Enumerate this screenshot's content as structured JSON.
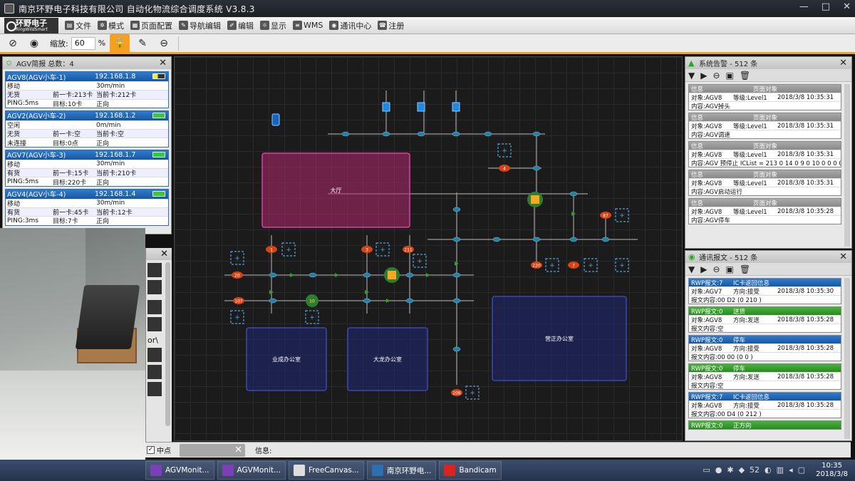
{
  "window": {
    "title": "南京环野电子科技有限公司   自动化物流综合调度系统 V3.8.3",
    "controls": [
      "—",
      "□",
      "✕"
    ]
  },
  "brand": {
    "cn": "环野电子",
    "en": "RingWildSmart"
  },
  "menu": [
    {
      "label": "文件",
      "icon": "file-icon"
    },
    {
      "label": "模式",
      "icon": "gear-icon"
    },
    {
      "label": "页面配置",
      "icon": "layout-icon"
    },
    {
      "label": "导航编辑",
      "icon": "nav-edit-icon"
    },
    {
      "label": "编辑",
      "icon": "edit-icon"
    },
    {
      "label": "显示",
      "icon": "display-icon"
    },
    {
      "label": "WMS",
      "icon": "database-icon"
    },
    {
      "label": "通讯中心",
      "icon": "comm-icon"
    },
    {
      "label": "注册",
      "icon": "register-icon"
    }
  ],
  "toolbar": {
    "zoom_label": "缩放:",
    "zoom_value": "60",
    "zoom_unit": "%"
  },
  "agv_panel": {
    "title": "AGV简报 总数：4",
    "items": [
      {
        "name": "AGV8(AGV小车-1)",
        "ip": "192.168.1.8",
        "battery": "low",
        "rows": [
          [
            "移动",
            "",
            "30m/min"
          ],
          [
            "无货",
            "前一卡:213卡",
            "当前卡:212卡"
          ],
          [
            "PING:5ms",
            "目标:10卡",
            "正向"
          ]
        ]
      },
      {
        "name": "AGV2(AGV小车-2)",
        "ip": "192.168.1.2",
        "battery": "ok",
        "rows": [
          [
            "空闲",
            "",
            "0m/min"
          ],
          [
            "无货",
            "前一卡:空",
            "当前卡:空"
          ],
          [
            "未连接",
            "目标:0点",
            "正向"
          ]
        ]
      },
      {
        "name": "AGV7(AGV小车-3)",
        "ip": "192.168.1.7",
        "battery": "ok",
        "rows": [
          [
            "移动",
            "",
            "30m/min"
          ],
          [
            "有货",
            "前一卡:15卡",
            "当前卡:210卡"
          ],
          [
            "PING:5ms",
            "目标:220卡",
            "正向"
          ]
        ]
      },
      {
        "name": "AGV4(AGV小车-4)",
        "ip": "192.168.1.4",
        "battery": "ok",
        "rows": [
          [
            "移动",
            "",
            "30m/min"
          ],
          [
            "有货",
            "前一卡:45卡",
            "当前卡:12卡"
          ],
          [
            "PING:3ms",
            "目标:7卡",
            "正向"
          ]
        ]
      }
    ]
  },
  "lower_left": {
    "text": "or\\"
  },
  "bottombar": {
    "checkbox_label": "中点",
    "info_label": "信息:"
  },
  "map": {
    "rooms": [
      {
        "label": "大厅",
        "style": "pink"
      },
      {
        "label": "业成办公室",
        "style": "blue"
      },
      {
        "label": "大龙办公室",
        "style": "blue"
      },
      {
        "label": "营正办公室",
        "style": "blue"
      }
    ],
    "card_labels": [
      "1",
      "3",
      "211",
      "20",
      "107",
      "10",
      "4",
      "87",
      "220",
      "7",
      "208"
    ]
  },
  "alarm_panel": {
    "title": "系统告警 - 512 条",
    "col_info": "信息",
    "col_page": "页面对象",
    "items": [
      {
        "obj": "对象:AGV8",
        "level": "等级:Level1",
        "time": "2018/3/8 10:35:31",
        "content": "内容:AGV掉头"
      },
      {
        "obj": "对象:AGV8",
        "level": "等级:Level1",
        "time": "2018/3/8 10:35:31",
        "content": "内容:AGV调速"
      },
      {
        "obj": "对象:AGV8",
        "level": "等级:Level1",
        "time": "2018/3/8 10:35:31",
        "content": "内容:AGV 预停止  ICList = 213 0 14 0 9 0 10 0 0 0 0"
      },
      {
        "obj": "对象:AGV8",
        "level": "等级:Level1",
        "time": "2018/3/8 10:35:31",
        "content": "内容:AGV启动运行"
      },
      {
        "obj": "对象:AGV8",
        "level": "等级:Level1",
        "time": "2018/3/8 10:35:28",
        "content": "内容:AGV停车"
      }
    ]
  },
  "comm_panel": {
    "title": "通讯报文 - 512 条",
    "items": [
      {
        "head": "RWP报文:7",
        "kind": "IC卡返回信息",
        "color": "blue",
        "obj": "对象:AGV7",
        "dir": "方向:接受",
        "time": "2018/3/8 10:35:30",
        "content": "报文内容:00 D2  (0 210 )"
      },
      {
        "head": "RWP报文:0",
        "kind": "送货",
        "color": "green",
        "obj": "对象:AGV8",
        "dir": "方向:发送",
        "time": "2018/3/8 10:35:28",
        "content": "报文内容:空"
      },
      {
        "head": "RWP报文:0",
        "kind": "停车",
        "color": "blue",
        "obj": "对象:AGV8",
        "dir": "方向:接受",
        "time": "2018/3/8 10:35:28",
        "content": "报文内容:00 00  (0 0 )"
      },
      {
        "head": "RWP报文:0",
        "kind": "停车",
        "color": "green",
        "obj": "对象:AGV8",
        "dir": "方向:发送",
        "time": "2018/3/8 10:35:28",
        "content": "报文内容:空"
      },
      {
        "head": "RWP报文:7",
        "kind": "IC卡返回信息",
        "color": "blue",
        "obj": "对象:AGV8",
        "dir": "方向:接受",
        "time": "2018/3/8 10:35:28",
        "content": "报文内容:00 D4  (0 212 )"
      },
      {
        "head": "RWP报文:0",
        "kind": "正方向",
        "color": "green",
        "obj": "",
        "dir": "",
        "time": "",
        "content": ""
      }
    ]
  },
  "taskbar": {
    "tasks": [
      {
        "label": "AGVMonit...",
        "color": "#7b3fb8"
      },
      {
        "label": "AGVMonit...",
        "color": "#7b3fb8"
      },
      {
        "label": "FreeCanvas...",
        "color": "#ddd"
      },
      {
        "label": "南京环野电...",
        "color": "#2f6fb0"
      },
      {
        "label": "Bandicam",
        "color": "#d22"
      }
    ],
    "tray_number": "52",
    "clock_time": "10:35",
    "clock_date": "2018/3/8"
  }
}
